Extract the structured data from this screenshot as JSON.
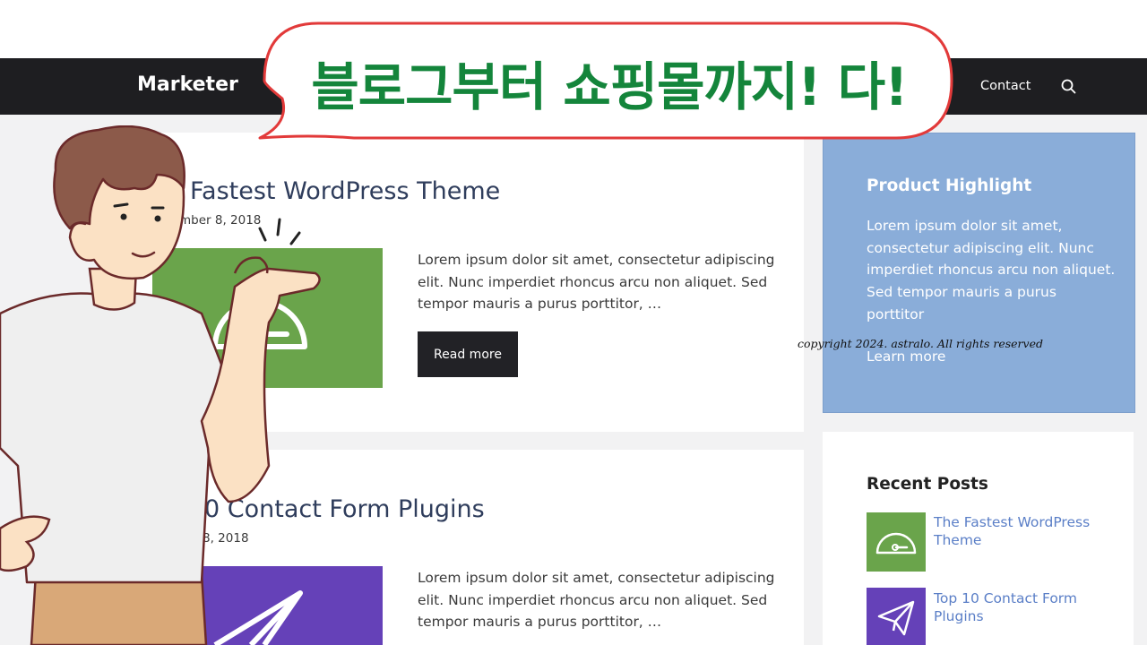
{
  "header": {
    "logo": "Marketer",
    "nav": {
      "contact": "Contact"
    },
    "search_icon": "search-icon"
  },
  "overlay": {
    "bubble_text": "블로그부터 쇼핑몰까지! 다!",
    "copyright": "copyright 2024. astralo. All rights reserved"
  },
  "posts": [
    {
      "title": "Fastest WordPress Theme",
      "date": "mber 8, 2018",
      "excerpt": "Lorem ipsum dolor sit amet, consectetur adipiscing elit. Nunc imperdiet rhoncus arcu non aliquet. Sed tempor mauris a purus porttitor, …",
      "read_more": "Read more",
      "thumb_icon": "speedometer-icon",
      "thumb_color": "#6aa44b"
    },
    {
      "title": "0 Contact Form Plugins",
      "date": "8, 2018",
      "excerpt": "Lorem ipsum dolor sit amet, consectetur adipiscing elit. Nunc imperdiet rhoncus arcu non aliquet. Sed tempor mauris a purus porttitor, …",
      "thumb_icon": "paper-plane-icon",
      "thumb_color": "#6541b8"
    }
  ],
  "sidebar": {
    "highlight": {
      "title": "Product Highlight",
      "text": "Lorem ipsum dolor sit amet, consectetur adipiscing elit. Nunc imperdiet rhoncus arcu non aliquet. Sed tempor mauris a purus porttitor",
      "learn_more": "Learn more",
      "bg_color": "#8aadd9"
    },
    "recent": {
      "heading": "Recent Posts",
      "items": [
        {
          "label": "The Fastest WordPress Theme",
          "icon": "speedometer-icon"
        },
        {
          "label": "Top 10 Contact Form Plugins",
          "icon": "paper-plane-icon"
        }
      ]
    }
  },
  "colors": {
    "header_bg": "#1e1e21",
    "bubble_text": "#14853b",
    "bubble_border": "#e23a3a",
    "link": "#5b7fc7"
  }
}
